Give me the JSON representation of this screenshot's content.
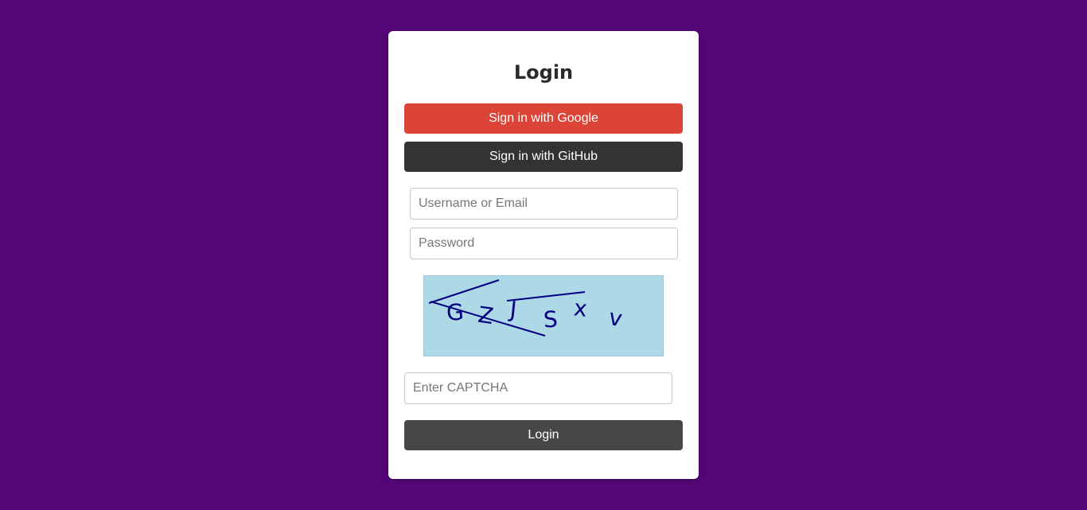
{
  "login_card": {
    "title": "Login",
    "google_button_label": "Sign in with Google",
    "github_button_label": "Sign in with GitHub",
    "username_placeholder": "Username or Email",
    "username_value": "",
    "password_placeholder": "Password",
    "password_value": "",
    "captcha": {
      "characters": [
        "G",
        "Z",
        "J",
        "S",
        "x",
        "v"
      ],
      "background_color": "#add8e6",
      "text_color": "#000080"
    },
    "captcha_placeholder": "Enter CAPTCHA",
    "captcha_value": "",
    "login_button_label": "Login"
  },
  "colors": {
    "page_background": "#540677",
    "google_button": "#db4437",
    "github_button": "#333333",
    "login_button": "#474747"
  }
}
